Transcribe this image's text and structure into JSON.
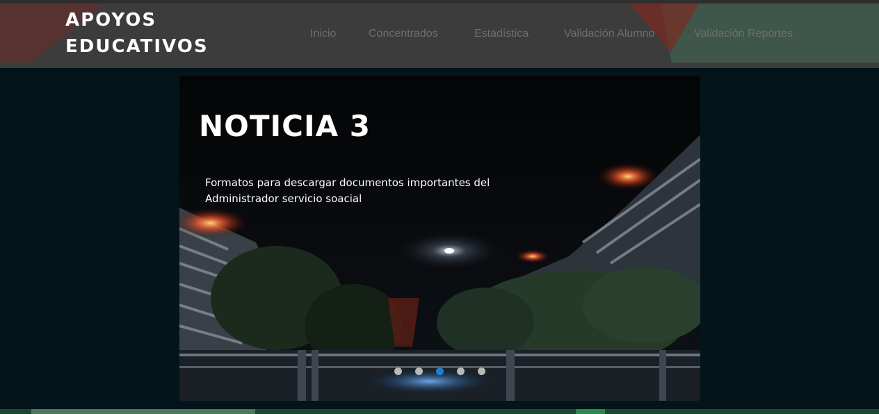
{
  "header": {
    "brand_line1": "APOYOS",
    "brand_line2": "EDUCATIVOS",
    "nav": [
      {
        "label": "Inicio"
      },
      {
        "label": "Concentrados"
      },
      {
        "label": "Estadística"
      },
      {
        "label": "Validación Alumno"
      },
      {
        "label": "Validación Reportes"
      }
    ]
  },
  "carousel": {
    "title": "NOTICIA 3",
    "text": "Formatos para descargar documentos importantes del Administrador servicio soacial",
    "slide_count": 5,
    "active_slide": 3
  },
  "colors": {
    "header_bg": "#3c3c3c",
    "page_bg": "#03141a",
    "active_dot": "#1e88e5",
    "inactive_dot": "#c9c9c9"
  }
}
